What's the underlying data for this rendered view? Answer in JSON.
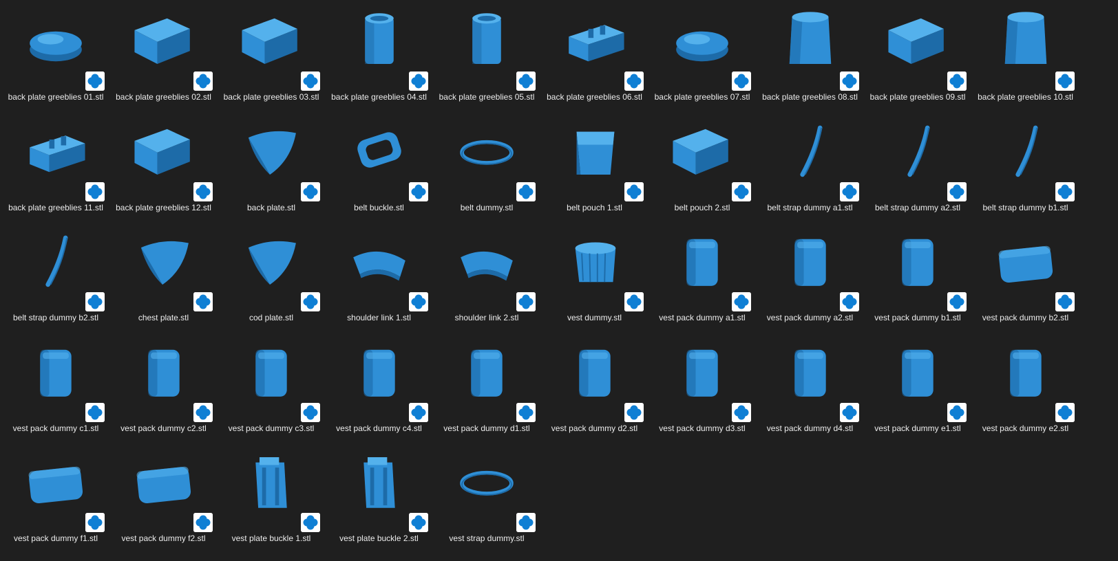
{
  "theme": {
    "background": "#1f1f1f",
    "text": "#ececec",
    "model_fill": "#2f8fd6",
    "model_shade": "#1d6ba8",
    "model_top": "#54b1ec",
    "badge_icon": "#0f7fd4",
    "badge_bg": "#ffffff"
  },
  "file_type_icon": "3d-builder-icon",
  "files": [
    {
      "name": "back plate greeblies 01.stl",
      "thumb": "disc"
    },
    {
      "name": "back plate greeblies 02.stl",
      "thumb": "box"
    },
    {
      "name": "back plate greeblies 03.stl",
      "thumb": "box"
    },
    {
      "name": "back plate greeblies 04.stl",
      "thumb": "cylinder"
    },
    {
      "name": "back plate greeblies 05.stl",
      "thumb": "cylinder"
    },
    {
      "name": "back plate greeblies 06.stl",
      "thumb": "notched"
    },
    {
      "name": "back plate greeblies 07.stl",
      "thumb": "disc"
    },
    {
      "name": "back plate greeblies 08.stl",
      "thumb": "taper"
    },
    {
      "name": "back plate greeblies 09.stl",
      "thumb": "box"
    },
    {
      "name": "back plate greeblies 10.stl",
      "thumb": "taper"
    },
    {
      "name": "back plate greeblies 11.stl",
      "thumb": "notched"
    },
    {
      "name": "back plate greeblies 12.stl",
      "thumb": "box"
    },
    {
      "name": "back plate.stl",
      "thumb": "shell"
    },
    {
      "name": "belt buckle.stl",
      "thumb": "buckle"
    },
    {
      "name": "belt dummy.stl",
      "thumb": "ring"
    },
    {
      "name": "belt pouch 1.stl",
      "thumb": "pouch"
    },
    {
      "name": "belt pouch 2.stl",
      "thumb": "box"
    },
    {
      "name": "belt strap dummy a1.stl",
      "thumb": "strap"
    },
    {
      "name": "belt strap dummy a2.stl",
      "thumb": "strap"
    },
    {
      "name": "belt strap dummy b1.stl",
      "thumb": "strap"
    },
    {
      "name": "belt strap dummy b2.stl",
      "thumb": "strap"
    },
    {
      "name": "chest plate.stl",
      "thumb": "shell"
    },
    {
      "name": "cod plate.stl",
      "thumb": "shell"
    },
    {
      "name": "shoulder link 1.stl",
      "thumb": "curvedplate"
    },
    {
      "name": "shoulder link 2.stl",
      "thumb": "curvedplate"
    },
    {
      "name": "vest dummy.stl",
      "thumb": "band"
    },
    {
      "name": "vest pack dummy a1.stl",
      "thumb": "pack"
    },
    {
      "name": "vest pack dummy a2.stl",
      "thumb": "pack"
    },
    {
      "name": "vest pack dummy b1.stl",
      "thumb": "pack"
    },
    {
      "name": "vest pack dummy b2.stl",
      "thumb": "widepack"
    },
    {
      "name": "vest pack dummy c1.stl",
      "thumb": "pack"
    },
    {
      "name": "vest pack dummy c2.stl",
      "thumb": "pack"
    },
    {
      "name": "vest pack dummy c3.stl",
      "thumb": "pack"
    },
    {
      "name": "vest pack dummy c4.stl",
      "thumb": "pack"
    },
    {
      "name": "vest pack dummy d1.stl",
      "thumb": "pack"
    },
    {
      "name": "vest pack dummy d2.stl",
      "thumb": "pack"
    },
    {
      "name": "vest pack dummy d3.stl",
      "thumb": "pack"
    },
    {
      "name": "vest pack dummy d4.stl",
      "thumb": "pack"
    },
    {
      "name": "vest pack dummy e1.stl",
      "thumb": "pack"
    },
    {
      "name": "vest pack dummy e2.stl",
      "thumb": "pack"
    },
    {
      "name": "vest pack dummy f1.stl",
      "thumb": "widepack"
    },
    {
      "name": "vest pack dummy f2.stl",
      "thumb": "widepack"
    },
    {
      "name": "vest plate buckle 1.stl",
      "thumb": "tower"
    },
    {
      "name": "vest plate buckle 2.stl",
      "thumb": "tower"
    },
    {
      "name": "vest strap dummy.stl",
      "thumb": "ring"
    }
  ]
}
